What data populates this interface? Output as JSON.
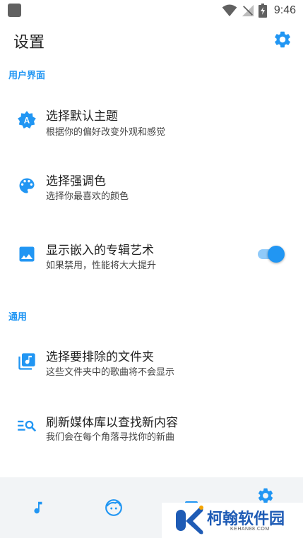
{
  "status_bar": {
    "time": "9:46",
    "icons": [
      "notification-square-icon",
      "wifi-icon",
      "no-signal-icon",
      "battery-charging-icon"
    ]
  },
  "toolbar": {
    "title": "设置",
    "settings_icon": "gear-icon"
  },
  "sections": [
    {
      "header": "用户界面",
      "items": [
        {
          "title": "选择默认主题",
          "summary": "根据你的偏好改变外观和感觉",
          "icon": "theme-badge-icon"
        },
        {
          "title": "选择强调色",
          "summary": "选择你最喜欢的颜色",
          "icon": "palette-icon"
        },
        {
          "title": "显示嵌入的专辑艺术",
          "summary": "如果禁用，性能将大大提升",
          "icon": "image-icon",
          "toggle": true
        }
      ]
    },
    {
      "header": "通用",
      "items": [
        {
          "title": "选择要排除的文件夹",
          "summary": "这些文件夹中的歌曲将不会显示",
          "icon": "music-library-icon"
        },
        {
          "title": "刷新媒体库以查找新内容",
          "summary": "我们会在每个角落寻找你的新曲",
          "icon": "search-list-icon"
        }
      ]
    }
  ],
  "bottom_nav": {
    "items": [
      "music-note-icon",
      "face-icon",
      "library-icon",
      "gear-icon"
    ],
    "selected": "gear-icon"
  },
  "watermark": {
    "name": "柯翰软件园",
    "domain": "KEHAN88.COM"
  },
  "colors": {
    "accent": "#2196f3",
    "accent_light": "#90caf9",
    "text_primary": "#212121",
    "text_secondary": "#444444",
    "nav_background": "#f2f4f6",
    "watermark_blue": "#1e5bb5"
  }
}
